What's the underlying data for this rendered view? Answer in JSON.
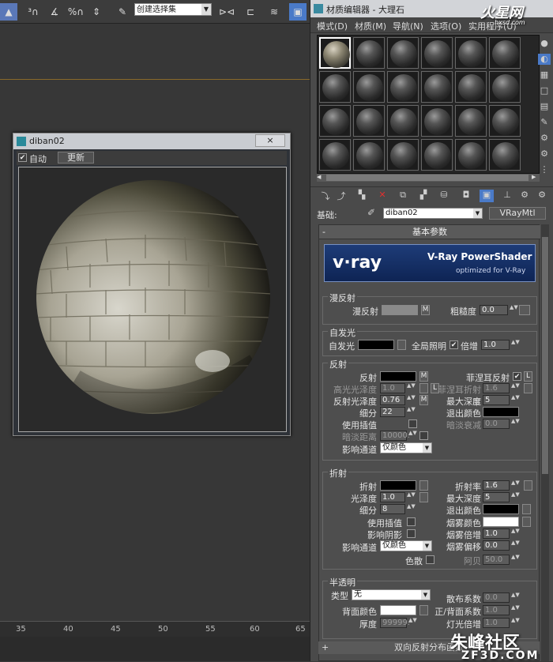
{
  "toolbar": {
    "selection_set": "创建选择集",
    "icons": [
      "select-icon",
      "snap-3-icon",
      "angle-snap-icon",
      "percent-snap-icon",
      "spinner-snap-icon",
      "edit-named-selection-icon",
      "mirror-icon",
      "align-icon",
      "layer-icon"
    ]
  },
  "viewport": {
    "ruler_ticks": [
      "35",
      "40",
      "45",
      "50",
      "55",
      "60",
      "65"
    ]
  },
  "preview_window": {
    "title": "diban02",
    "close": "×",
    "auto_label": "自动",
    "auto_checked": true,
    "update_button": "更新"
  },
  "material_editor": {
    "title": "材质编辑器 - 大理石",
    "menu": [
      "模式(D)",
      "材质(M)",
      "导航(N)",
      "选项(O)",
      "实用程序(U)"
    ],
    "base_label": "基础:",
    "material_name": "diban02",
    "material_type": "VRayMtl",
    "rollout_title": "基本参数",
    "banner": {
      "logo": "v·ray",
      "title": "V-Ray PowerShader",
      "subtitle": "optimized for V-Ray"
    },
    "diffuse": {
      "group": "漫反射",
      "diffuse_label": "漫反射",
      "roughness_label": "粗糙度",
      "roughness": "0.0"
    },
    "self_illum": {
      "group": "自发光",
      "label": "自发光",
      "gi_label": "全局照明",
      "mult_label": "倍增",
      "mult": "1.0"
    },
    "reflection": {
      "group": "反射",
      "reflect_label": "反射",
      "hilight_gloss_label": "高光光泽度",
      "hilight_gloss": "1.0",
      "refl_gloss_label": "反射光泽度",
      "refl_gloss": "0.76",
      "subdivs_label": "细分",
      "subdivs": "22",
      "use_interp_label": "使用插值",
      "dim_dist_label": "暗淡距离",
      "dim_dist": "10000.",
      "affect_ch_label": "影响通道",
      "affect_ch": "仅颜色",
      "fresnel_label": "菲涅耳反射",
      "fresnel_ior_label": "菲涅耳折射率",
      "fresnel_ior": "1.6",
      "max_depth_label": "最大深度",
      "max_depth": "5",
      "exit_color_label": "退出颜色",
      "dim_falloff_label": "暗淡衰减",
      "dim_falloff": "0.0",
      "L": "L"
    },
    "refraction": {
      "group": "折射",
      "refract_label": "折射",
      "gloss_label": "光泽度",
      "gloss": "1.0",
      "subdivs_label": "细分",
      "subdivs": "8",
      "use_interp_label": "使用插值",
      "affect_shadows_label": "影响阴影",
      "affect_ch_label": "影响通道",
      "affect_ch": "仅颜色",
      "dispersion_label": "色散",
      "ior_label": "折射率",
      "ior": "1.6",
      "max_depth_label": "最大深度",
      "max_depth": "5",
      "exit_color_label": "退出颜色",
      "fog_color_label": "烟雾颜色",
      "fog_mult_label": "烟雾倍增",
      "fog_mult": "1.0",
      "fog_bias_label": "烟雾偏移",
      "fog_bias": "0.0",
      "abbe_label": "阿贝",
      "abbe": "50.0"
    },
    "translucency": {
      "group": "半透明",
      "type_label": "类型",
      "type_value": "无",
      "back_color_label": "背面颜色",
      "thickness_label": "厚度",
      "thickness": "99999.",
      "scatter_label": "散布系数",
      "scatter": "0.0",
      "fwd_back_label": "正/背面系数",
      "fwd_back": "1.0",
      "light_mult_label": "灯光倍增",
      "light_mult": "1.0"
    },
    "next_rollout": "双向反射分布函数"
  },
  "watermarks": {
    "top": "火星网",
    "top_sub": "hxsd.com",
    "bottom": "朱峰社区",
    "bottom_sub": "ZF3D.COM"
  },
  "colors": {
    "accent": "#3a6ab0",
    "diffuse_swatch": "#8a8a8a",
    "black_swatch": "#000000",
    "white_swatch": "#ffffff"
  }
}
